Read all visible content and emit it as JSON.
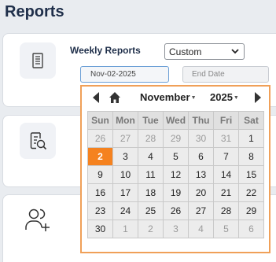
{
  "page": {
    "title": "Reports"
  },
  "report": {
    "name": "Weekly Reports",
    "range_select": "Custom",
    "start_date": "Nov-02-2025",
    "end_placeholder": "End Date"
  },
  "calendar": {
    "month": "November",
    "year": "2025",
    "weekdays": [
      "Sun",
      "Mon",
      "Tue",
      "Wed",
      "Thu",
      "Fri",
      "Sat"
    ],
    "weeks": [
      [
        "26",
        "27",
        "28",
        "29",
        "30",
        "31",
        "1"
      ],
      [
        "2",
        "3",
        "4",
        "5",
        "6",
        "7",
        "8"
      ],
      [
        "9",
        "10",
        "11",
        "12",
        "13",
        "14",
        "15"
      ],
      [
        "16",
        "17",
        "18",
        "19",
        "20",
        "21",
        "22"
      ],
      [
        "23",
        "24",
        "25",
        "26",
        "27",
        "28",
        "29"
      ],
      [
        "30",
        "1",
        "2",
        "3",
        "4",
        "5",
        "6"
      ]
    ],
    "selected_day": "2",
    "accent_color": "#f5821f"
  },
  "icons": [
    "document-icon",
    "search-document-icon",
    "add-users-icon",
    "chevron-left-icon",
    "home-icon",
    "chevron-right-icon",
    "chevron-down-icon"
  ]
}
